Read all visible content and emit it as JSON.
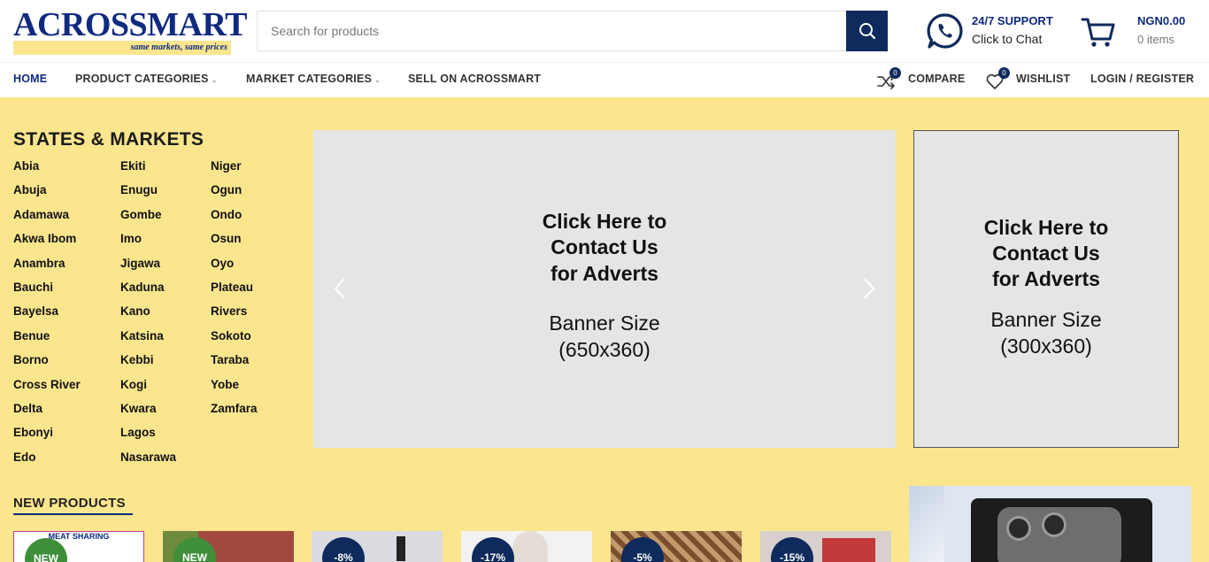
{
  "header": {
    "logo_text": "ACROSSMART",
    "logo_tagline": "same markets, same prices",
    "search_placeholder": "Search for products",
    "support_title": "24/7 SUPPORT",
    "support_sub": "Click to Chat",
    "cart_amount": "NGN0.00",
    "cart_items": "0 items"
  },
  "nav": {
    "home": "HOME",
    "product_categories": "PRODUCT CATEGORIES",
    "market_categories": "MARKET CATEGORIES",
    "sell": "SELL ON ACROSSMART",
    "compare": "COMPARE",
    "compare_count": "0",
    "wishlist": "WISHLIST",
    "wishlist_count": "0",
    "login": "LOGIN / REGISTER"
  },
  "states": {
    "title": "STATES & MARKETS",
    "col1": [
      "Abia",
      "Abuja",
      "Adamawa",
      "Akwa Ibom",
      "Anambra",
      "Bauchi",
      "Bayelsa",
      "Benue",
      "Borno",
      "Cross River",
      "Delta",
      "Ebonyi",
      "Edo"
    ],
    "col2": [
      "Ekiti",
      "Enugu",
      "Gombe",
      "Imo",
      "Jigawa",
      "Kaduna",
      "Kano",
      "Katsina",
      "Kebbi",
      "Kogi",
      "Kwara",
      "Lagos",
      "Nasarawa"
    ],
    "col3": [
      "Niger",
      "Ogun",
      "Ondo",
      "Osun",
      "Oyo",
      "Plateau",
      "Rivers",
      "Sokoto",
      "Taraba",
      "Yobe",
      "Zamfara"
    ]
  },
  "banner_main": {
    "line1": "Click Here to",
    "line2": "Contact Us",
    "line3": "for Adverts",
    "size1": "Banner Size",
    "size2": "(650x360)"
  },
  "banner_side": {
    "line1": "Click Here to",
    "line2": "Contact Us",
    "line3": "for Adverts",
    "size1": "Banner Size",
    "size2": "(300x360)"
  },
  "new_products": {
    "title": "NEW PRODUCTS",
    "items": [
      {
        "tag": "NEW",
        "kind": "new",
        "caption": "MEAT SHARING",
        "bg": "#ffffff"
      },
      {
        "tag": "NEW",
        "kind": "new",
        "caption": "",
        "bg": "#a3483f"
      },
      {
        "tag": "-8%",
        "kind": "sale",
        "caption": "",
        "bg": "#d9dbe0"
      },
      {
        "tag": "-17%",
        "kind": "sale",
        "caption": "",
        "bg": "#f2f2f2"
      },
      {
        "tag": "-5%",
        "kind": "sale",
        "caption": "",
        "bg": "#9a6b45"
      },
      {
        "tag": "-15%",
        "kind": "sale",
        "caption": "",
        "bg": "#d8d0cc"
      }
    ]
  },
  "colors": {
    "brand_navy": "#0f2a80",
    "button_navy": "#0f2a5c",
    "page_yellow": "#fbe68e",
    "banner_gray": "#e5e5e5",
    "new_green": "#3f8f3a"
  }
}
